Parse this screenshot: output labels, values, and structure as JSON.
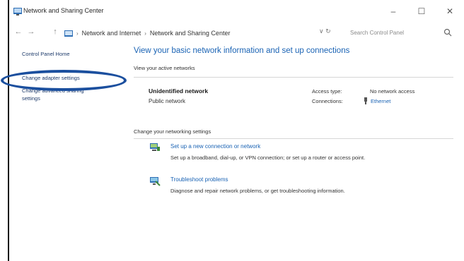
{
  "window": {
    "title": "Network and Sharing Center",
    "caption_buttons": {
      "minimize": "–",
      "maximize": "☐",
      "close": "✕"
    }
  },
  "address_bar": {
    "back": "←",
    "forward": "→",
    "up": "↑",
    "crumbs": [
      "Network and Internet",
      "Network and Sharing Center"
    ],
    "refresh": "∨  ↻",
    "search_placeholder": "Search Control Panel"
  },
  "left_pane": {
    "home_link": "Control Panel Home",
    "change_adapter": "Change adapter settings",
    "change_advanced_line1": "Change advanced sharing",
    "change_advanced_line2": "settings"
  },
  "main": {
    "title": "View your basic network information and set up connections",
    "active_networks_label": "View your active networks",
    "network": {
      "name": "Unidentified network",
      "type": "Public network",
      "access_type_label": "Access type:",
      "access_type_value": "No network access",
      "connections_label": "Connections:",
      "connections_value": "Ethernet"
    },
    "change_settings_label": "Change your networking settings",
    "tasks": [
      {
        "link": "Set up a new connection or network",
        "desc": "Set up a broadband, dial-up, or VPN connection; or set up a router or access point."
      },
      {
        "link": "Troubleshoot problems",
        "desc": "Diagnose and repair network problems, or get troubleshooting information."
      }
    ]
  },
  "colors": {
    "link": "#1a63b4",
    "highlight": "#1b4f9e",
    "title_text": "#1a63b4"
  }
}
